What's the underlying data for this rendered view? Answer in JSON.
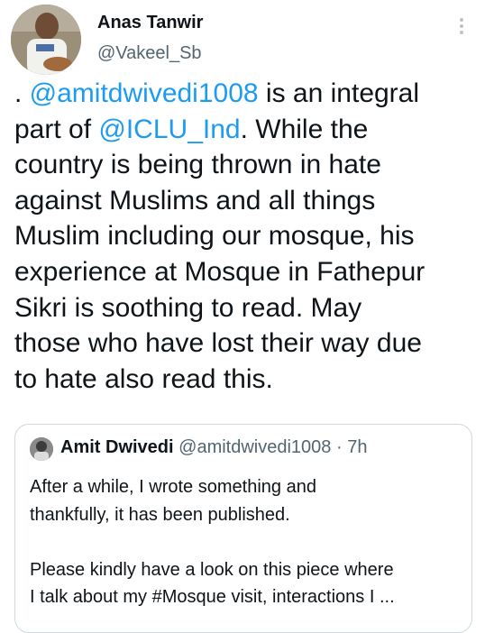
{
  "author": {
    "name": "Anas Tanwir",
    "handle": "@Vakeel_Sb",
    "avatar_icon": "profile-photo"
  },
  "more_icon": "vertical-ellipsis-icon",
  "tweet": {
    "lines": [
      [
        {
          "t": ". ",
          "m": false
        },
        {
          "t": "@amitdwivedi1008",
          "m": true
        },
        {
          "t": " is an integral",
          "m": false
        }
      ],
      [
        {
          "t": "part of ",
          "m": false
        },
        {
          "t": "@ICLU_Ind",
          "m": true
        },
        {
          "t": ". While the",
          "m": false
        }
      ],
      [
        {
          "t": "country is being thrown in hate",
          "m": false
        }
      ],
      [
        {
          "t": "against Muslims and all things",
          "m": false
        }
      ],
      [
        {
          "t": "Muslim including our mosque, his",
          "m": false
        }
      ],
      [
        {
          "t": "experience at Mosque in Fathepur",
          "m": false
        }
      ],
      [
        {
          "t": "Sikri is soothing to read. May",
          "m": false
        }
      ],
      [
        {
          "t": "those who have lost their way due",
          "m": false
        }
      ],
      [
        {
          "t": "to hate also read this.",
          "m": false
        }
      ]
    ]
  },
  "quoted": {
    "name": "Amit Dwivedi",
    "handle": "@amitdwivedi1008",
    "separator": "·",
    "time": "7h",
    "para1": [
      "After a while, I wrote something and",
      "thankfully, it has been published."
    ],
    "para2": [
      "Please kindly have a look on this piece where",
      "I talk about my #Mosque visit, interactions I ..."
    ]
  },
  "colors": {
    "link": "#1d9bf0",
    "secondary": "#536471",
    "text": "#0f1419",
    "border": "#cfd9de"
  }
}
